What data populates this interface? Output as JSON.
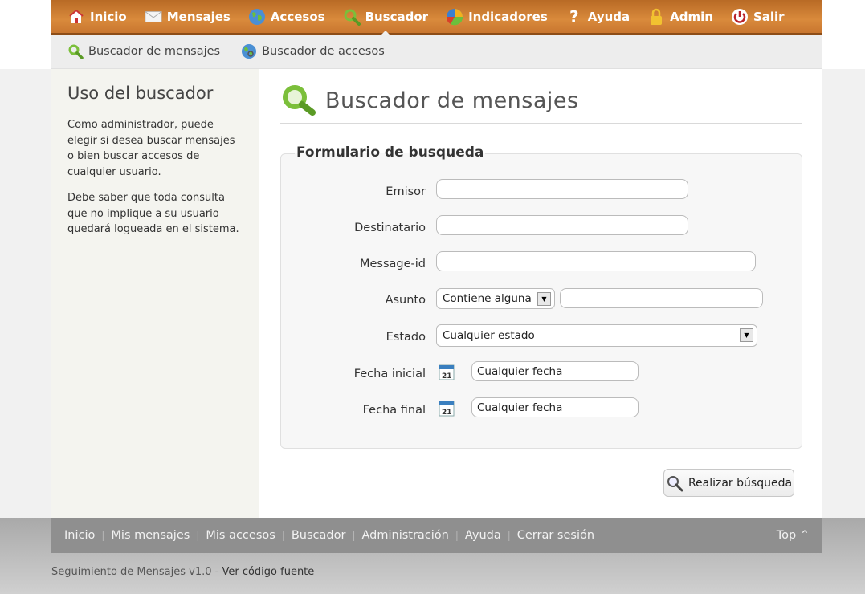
{
  "nav": {
    "items": [
      {
        "label": "Inicio",
        "icon": "home-icon"
      },
      {
        "label": "Mensajes",
        "icon": "envelope-icon"
      },
      {
        "label": "Accesos",
        "icon": "globe-icon"
      },
      {
        "label": "Buscador",
        "icon": "search-icon"
      },
      {
        "label": "Indicadores",
        "icon": "pie-chart-icon"
      },
      {
        "label": "Ayuda",
        "icon": "help-icon"
      },
      {
        "label": "Admin",
        "icon": "lock-icon"
      },
      {
        "label": "Salir",
        "icon": "power-icon"
      }
    ],
    "active": "Buscador"
  },
  "subnav": {
    "items": [
      {
        "label": "Buscador de mensajes",
        "icon": "search-icon"
      },
      {
        "label": "Buscador de accesos",
        "icon": "globe-search-icon"
      }
    ]
  },
  "sidebar": {
    "title": "Uso del buscador",
    "p1": "Como administrador, puede elegir si desea buscar mensajes o bien buscar accesos de cualquier usuario.",
    "p2": "Debe saber que toda consulta que no implique a su usuario quedará logueada en el sistema."
  },
  "page": {
    "title": "Buscador de mensajes"
  },
  "form": {
    "legend": "Formulario de busqueda",
    "emisor_label": "Emisor",
    "emisor_value": "",
    "destinatario_label": "Destinatario",
    "destinatario_value": "",
    "messageid_label": "Message-id",
    "messageid_value": "",
    "asunto_label": "Asunto",
    "asunto_select": "Contiene alguna",
    "asunto_value": "",
    "estado_label": "Estado",
    "estado_select": "Cualquier estado",
    "fecha_inicial_label": "Fecha inicial",
    "fecha_inicial_value": "Cualquier fecha",
    "fecha_final_label": "Fecha final",
    "fecha_final_value": "Cualquier fecha",
    "calendar_day": "21",
    "submit_label": "Realizar búsqueda"
  },
  "footer": {
    "links": [
      "Inicio",
      "Mis mensajes",
      "Mis accesos",
      "Buscador",
      "Administración",
      "Ayuda",
      "Cerrar sesión"
    ],
    "top_label": "Top ⌃"
  },
  "bottom": {
    "text": "Seguimiento de Mensajes v1.0 - ",
    "source_link": "Ver código fuente"
  },
  "colors": {
    "nav_orange": "#d98a3c",
    "footer_gray": "#8f8f8f",
    "sidebar_bg": "#f4f4ef"
  }
}
